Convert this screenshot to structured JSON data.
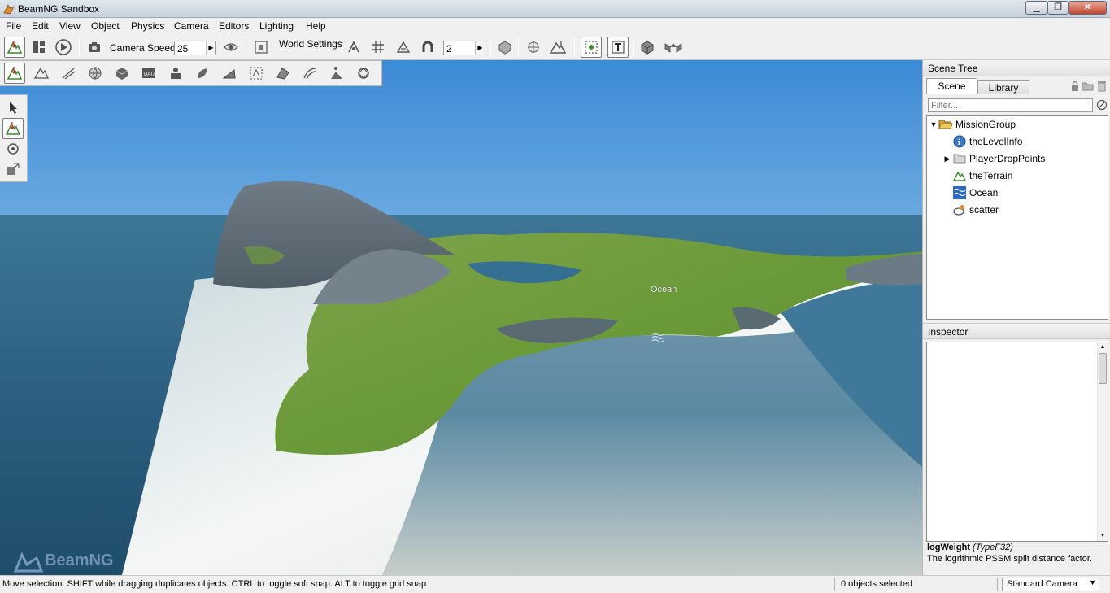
{
  "window": {
    "title": "BeamNG Sandbox"
  },
  "menu": [
    "File",
    "Edit",
    "View",
    "Object",
    "Physics",
    "Camera",
    "Editors",
    "Lighting",
    "Help"
  ],
  "toolbar": {
    "camera_speed_label": "Camera Speed",
    "camera_speed_value": "25",
    "world_settings_label": "World Settings",
    "snap_value": "2"
  },
  "viewport": {
    "ocean_label": "Ocean",
    "watermark": "BeamNG"
  },
  "scene_tree": {
    "header": "Scene Tree",
    "tabs": [
      "Scene",
      "Library"
    ],
    "filter_placeholder": "Filter...",
    "items": [
      {
        "label": "MissionGroup",
        "icon": "folder-open-icon",
        "expanded": true
      },
      {
        "label": "theLevelInfo",
        "icon": "info-icon"
      },
      {
        "label": "PlayerDropPoints",
        "icon": "folder-icon",
        "expandable": true
      },
      {
        "label": "theTerrain",
        "icon": "terrain-icon"
      },
      {
        "label": "Ocean",
        "icon": "water-icon"
      },
      {
        "label": "scatter",
        "icon": "scatter-icon"
      }
    ]
  },
  "inspector": {
    "header": "Inspector",
    "field_name": "logWeight",
    "field_type": "(TypeF32)",
    "description": "The logrithmic PSSM split distance factor."
  },
  "statusbar": {
    "message": "Move selection.  SHIFT while dragging duplicates objects.  CTRL to toggle soft snap.  ALT to toggle grid snap.",
    "selection": "0 objects selected",
    "camera": "Standard Camera"
  },
  "colors": {
    "sky": "#4a92d8",
    "sea": "#2f6688",
    "terrain": "#6e9a3c",
    "sand": "#e8ecea"
  }
}
